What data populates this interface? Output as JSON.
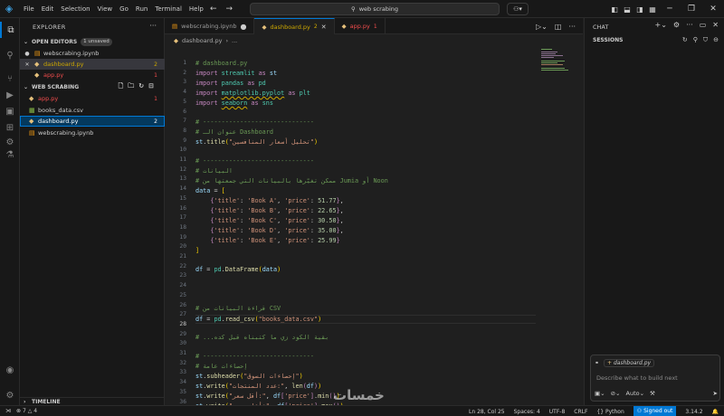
{
  "menu": [
    "File",
    "Edit",
    "Selection",
    "View",
    "Go",
    "Run",
    "Terminal",
    "Help"
  ],
  "search": {
    "text": "web scrabing"
  },
  "sidebar": {
    "title": "EXPLORER",
    "open_editors": {
      "header": "OPEN EDITORS",
      "badge": "1 unsaved",
      "items": [
        {
          "name": "webscrabing.ipynb",
          "count": ""
        },
        {
          "name": "dashboard.py",
          "count": "2"
        },
        {
          "name": "app.py",
          "count": "1"
        }
      ]
    },
    "folder": {
      "header": "WEB SCRABING",
      "items": [
        {
          "name": "app.py",
          "count": "1"
        },
        {
          "name": "books_data.csv",
          "count": ""
        },
        {
          "name": "dashboard.py",
          "count": "2"
        },
        {
          "name": "webscrabing.ipynb",
          "count": ""
        }
      ]
    },
    "timeline": "TIMELINE"
  },
  "tabs": [
    {
      "label": "webscrabing.ipynb",
      "marker": "●"
    },
    {
      "label": "dashboard.py",
      "count": "2"
    },
    {
      "label": "app.py",
      "count": "1"
    }
  ],
  "breadcrumb": {
    "file": "dashboard.py",
    "more": "..."
  },
  "code": {
    "line_numbers": [
      "1",
      "2",
      "3",
      "4",
      "5",
      "6",
      "7",
      "8",
      "9",
      "10",
      "11",
      "12",
      "13",
      "14",
      "15",
      "16",
      "17",
      "18",
      "19",
      "20",
      "21",
      "22",
      "23",
      "24",
      "25",
      "26",
      "27",
      "28",
      "29",
      "30",
      "31",
      "32",
      "33",
      "34",
      "35",
      "36",
      "37"
    ],
    "current_line": "28"
  },
  "chat": {
    "title": "CHAT",
    "sessions": "SESSIONS",
    "context_file": "dashboard.py",
    "placeholder": "Describe what to build next",
    "mode": "Auto"
  },
  "status": {
    "errors": "7",
    "warnings": "4",
    "position": "Ln 28, Col 25",
    "spaces": "Spaces: 4",
    "encoding": "UTF-8",
    "eol": "CRLF",
    "language": "Python",
    "account": "Signed out",
    "version": "3.14.2"
  },
  "watermark": "خمسات"
}
